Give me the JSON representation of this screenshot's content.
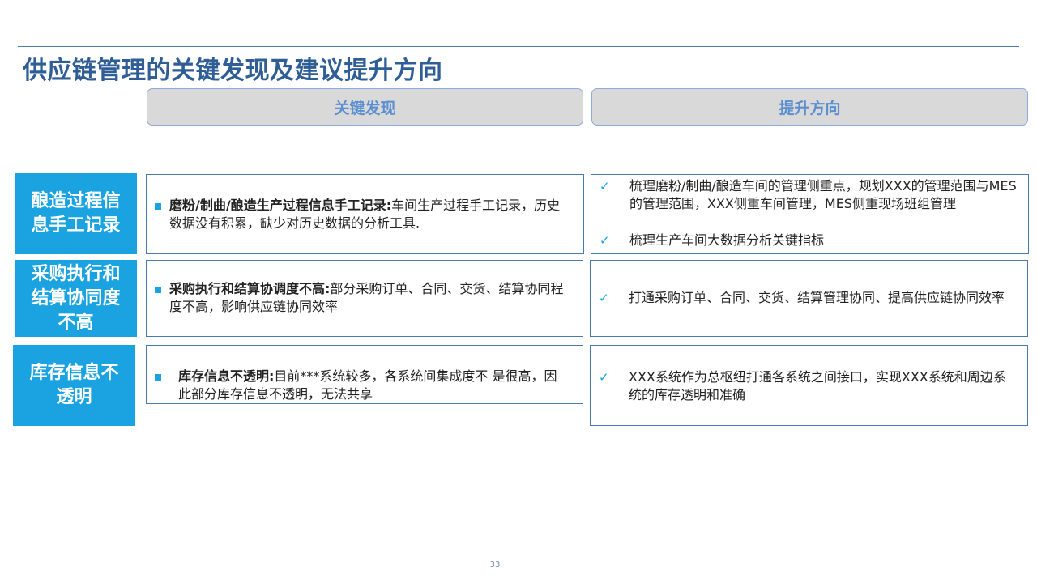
{
  "title": "供应链管理的关键发现及建议提升方向",
  "headers": {
    "findings": "关键发现",
    "directions": "提升方向"
  },
  "rows": [
    {
      "label": "酿造过程信息手工记录",
      "finding": {
        "bold": "磨粉/制曲/酿造生产过程信息手工记录:",
        "text": "车间生产过程手工记录，历史数据没有积累，缺少对历史数据的分析工具."
      },
      "directions": [
        "梳理磨粉/制曲/酿造车间的管理侧重点，规划XXX的管理范围与MES的管理范围，XXX侧重车间管理，MES侧重现场班组管理",
        "梳理生产车间大数据分析关键指标"
      ]
    },
    {
      "label": "采购执行和结算协同度不高",
      "finding": {
        "bold": "采购执行和结算协调度不高:",
        "text": "部分采购订单、合同、交货、结算协同程度不高，影响供应链协同效率"
      },
      "directions": [
        "打通采购订单、合同、交货、结算管理协同、提高供应链协同效率"
      ]
    },
    {
      "label": "库存信息不透明",
      "finding": {
        "bold": "库存信息不透明:",
        "text": "目前***系统较多，各系统间集成度不 是很高，因此部分库存信息不透明，无法共享"
      },
      "directions": [
        "XXX系统作为总枢纽打通各系统之间接口，实现XXX系统和周边系统的库存透明和准确"
      ]
    }
  ],
  "page_number": "33",
  "icons": {
    "bullet": "square-bullet-icon",
    "check": "checkmark-icon"
  },
  "colors": {
    "accent": "#1aa3e0",
    "title": "#2f5e97",
    "header_bg": "#d9d9d9",
    "header_text": "#5b8fd0",
    "border": "#4a78b0"
  }
}
